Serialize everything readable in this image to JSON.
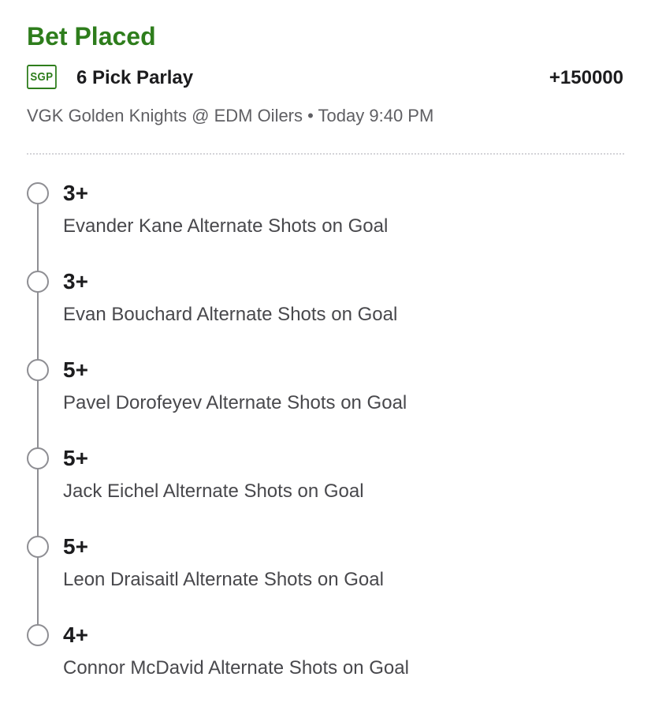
{
  "bet": {
    "status": "Bet Placed",
    "badge": "SGP",
    "title": "6 Pick Parlay",
    "odds": "+150000",
    "matchup": "VGK Golden Knights @ EDM Oilers • Today 9:40 PM"
  },
  "colors": {
    "accent_green": "#2e7d1c",
    "timeline_gray": "#8e8e93"
  },
  "legs": [
    {
      "line": "3+",
      "market": "Evander Kane Alternate Shots on Goal"
    },
    {
      "line": "3+",
      "market": "Evan Bouchard Alternate Shots on Goal"
    },
    {
      "line": "5+",
      "market": "Pavel Dorofeyev Alternate Shots on Goal"
    },
    {
      "line": "5+",
      "market": "Jack Eichel Alternate Shots on Goal"
    },
    {
      "line": "5+",
      "market": "Leon Draisaitl Alternate Shots on Goal"
    },
    {
      "line": "4+",
      "market": "Connor McDavid Alternate Shots on Goal"
    }
  ]
}
